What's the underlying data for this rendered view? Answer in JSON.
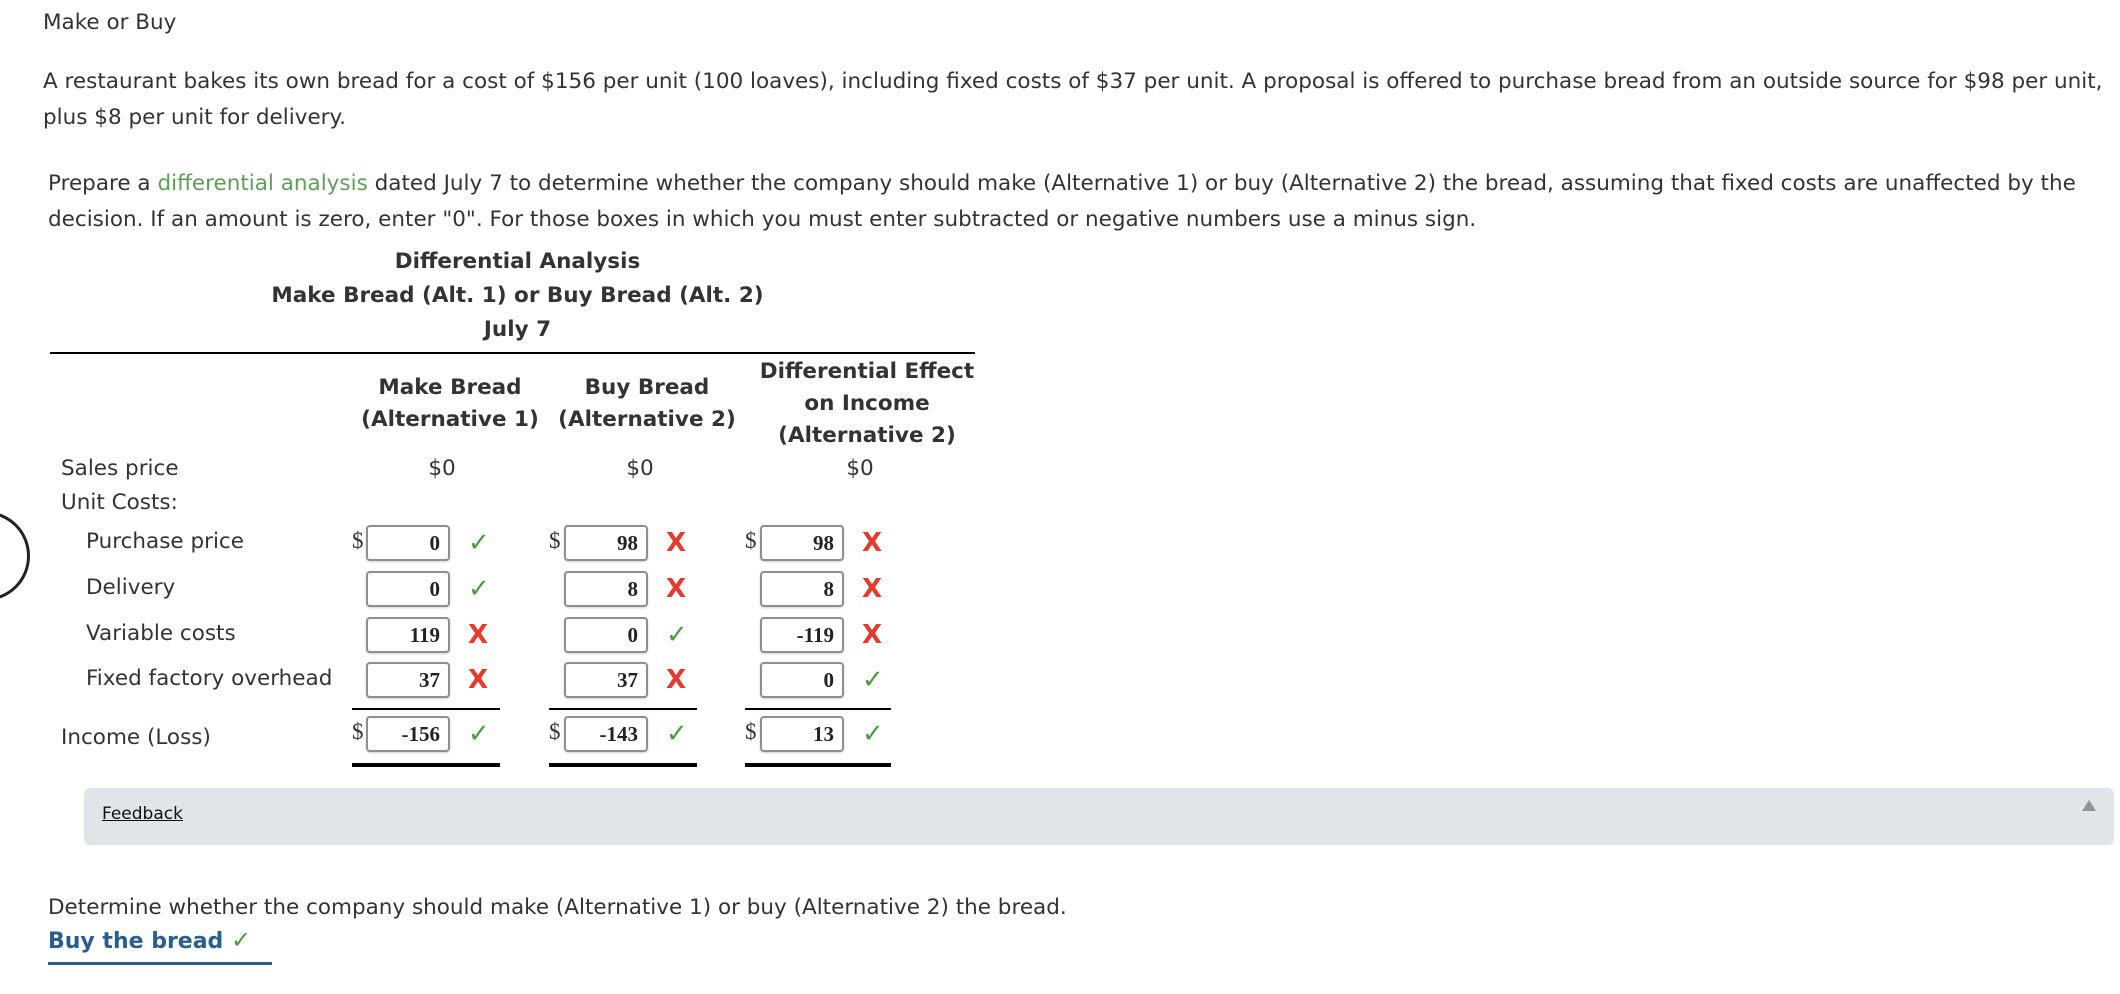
{
  "page": {
    "title": "Make or Buy",
    "problem_text": "A restaurant bakes its own bread for a cost of $156 per unit (100 loaves), including fixed costs of $37 per unit. A proposal is offered to purchase bread from an outside source for $98 per unit, plus $8 per unit for delivery.",
    "instructions": {
      "before_link": "Prepare a ",
      "link_text": "differential analysis",
      "after_link": " dated July 7 to determine whether the company should make (Alternative 1) or buy (Alternative 2) the bread, assuming that fixed costs are unaffected by the decision. If an amount is zero, enter \"0\". For those boxes in which you must enter subtracted or negative numbers use a minus sign."
    }
  },
  "table": {
    "heading": "Differential Analysis",
    "subheading": "Make Bread (Alt. 1) or Buy Bread (Alt. 2)",
    "date": "July 7",
    "columns": [
      {
        "line1": "Make Bread",
        "line2": "(Alternative 1)"
      },
      {
        "line1": "Buy Bread",
        "line2": "(Alternative 2)"
      },
      {
        "line1": "Differential Effect",
        "line2": "on Income",
        "line3": "(Alternative 2)"
      }
    ],
    "sales_price": {
      "label": "Sales price",
      "values": [
        "$0",
        "$0",
        "$0"
      ]
    },
    "unit_costs_label": "Unit Costs:",
    "currency_symbol": "$",
    "rows": [
      {
        "label": "Purchase price",
        "values": [
          "0",
          "98",
          "98"
        ],
        "status": [
          "correct",
          "incorrect",
          "incorrect"
        ]
      },
      {
        "label": "Delivery",
        "values": [
          "0",
          "8",
          "8"
        ],
        "status": [
          "correct",
          "incorrect",
          "incorrect"
        ]
      },
      {
        "label": "Variable costs",
        "values": [
          "119",
          "0",
          "-119"
        ],
        "status": [
          "incorrect",
          "correct",
          "incorrect"
        ]
      },
      {
        "label": "Fixed factory overhead",
        "values": [
          "37",
          "37",
          "0"
        ],
        "status": [
          "incorrect",
          "incorrect",
          "correct"
        ]
      }
    ],
    "income": {
      "label": "Income (Loss)",
      "values": [
        "-156",
        "-143",
        "13"
      ],
      "status": [
        "correct",
        "correct",
        "correct"
      ]
    }
  },
  "icons": {
    "correct": "✓",
    "incorrect": "X"
  },
  "feedback": {
    "label": "Feedback",
    "toggle_icon": "triangle-up-icon"
  },
  "decision": {
    "question": "Determine whether the company should make (Alternative 1) or buy (Alternative 2) the bread.",
    "answer": "Buy the bread",
    "status": "correct"
  },
  "colors": {
    "correct": "#4a9a3f",
    "incorrect": "#e53a2f",
    "link": "#5f9e57",
    "answer": "#2a5e91",
    "feedback_bg": "#dfe5e9"
  }
}
